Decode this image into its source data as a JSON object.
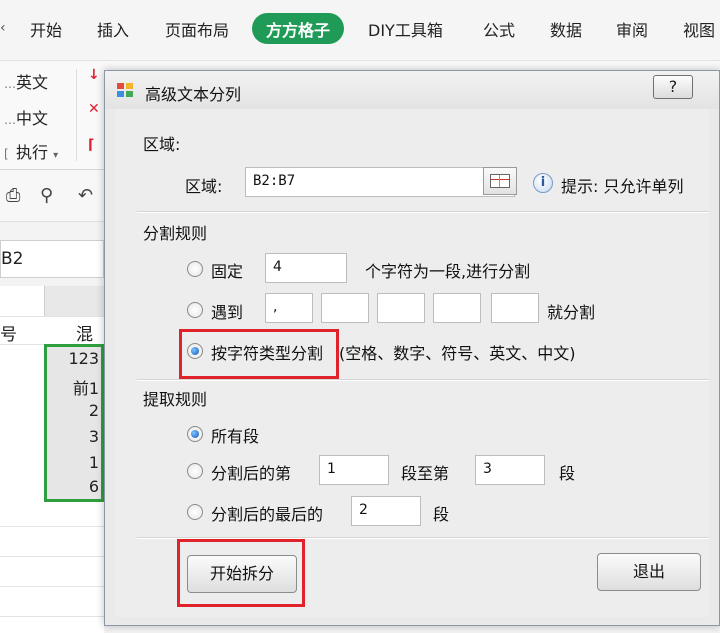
{
  "ribbon": {
    "tabs": [
      "开始",
      "插入",
      "页面布局",
      "方方格子",
      "DIY工具箱",
      "公式",
      "数据",
      "审阅",
      "视图"
    ],
    "active_tab": "方方格子",
    "accent": "#1f9b57",
    "group_items": [
      "英文",
      "中文",
      "执行"
    ]
  },
  "namebox": "B2",
  "sheet": {
    "col_a_header_fragment": "号",
    "col_b_header_fragment": "混",
    "selected_cells": [
      "123",
      "前1",
      "2",
      "3",
      "1",
      "6"
    ]
  },
  "dialog": {
    "title": "高级文本分列",
    "help_label": "?",
    "region": {
      "section_label": "区域:",
      "field_label": "区域:",
      "value": "B2:B7",
      "hint": "提示: 只允许单列"
    },
    "split_rules": {
      "section_label": "分割规则",
      "fixed_label": "固定",
      "fixed_value": "4",
      "fixed_suffix": "个字符为一段,进行分割",
      "meet_label": "遇到",
      "meet_values": [
        ",",
        "",
        "",
        "",
        ""
      ],
      "meet_suffix": "就分割",
      "by_type_label": "按字符类型分割",
      "by_type_note": "(空格、数字、符号、英文、中文)",
      "selected": "by_type"
    },
    "extract_rules": {
      "section_label": "提取规则",
      "all_label": "所有段",
      "range_prefix": "分割后的第",
      "range_from": "1",
      "range_mid": "段至第",
      "range_to": "3",
      "range_suffix": "段",
      "last_prefix": "分割后的最后的",
      "last_value": "2",
      "last_suffix": "段",
      "selected": "all"
    },
    "start_button": "开始拆分",
    "exit_button": "退出"
  },
  "highlight_color": "#e0232a"
}
